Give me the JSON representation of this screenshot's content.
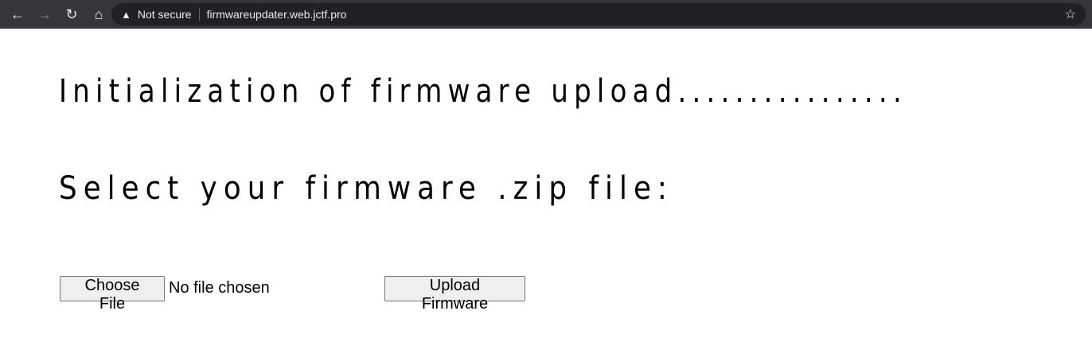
{
  "browser": {
    "security_label": "Not secure",
    "url": "firmwareupdater.web.jctf.pro"
  },
  "page": {
    "title": "Initialization of firmware upload................",
    "prompt": "Select your firmware .zip file:",
    "choose_file_label": "Choose File",
    "file_status": "No file chosen",
    "upload_label": "Upload Firmware"
  }
}
